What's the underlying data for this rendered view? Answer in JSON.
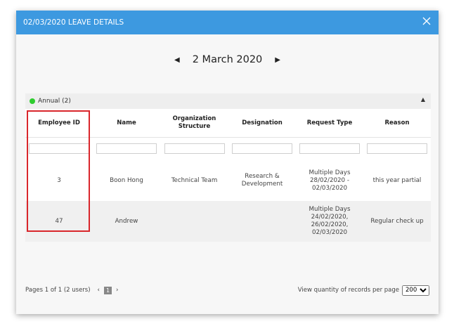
{
  "modal": {
    "title": "02/03/2020 LEAVE DETAILS",
    "date_nav": {
      "label": "2 March 2020",
      "prev": "◀",
      "next": "▶"
    }
  },
  "group": {
    "label": "Annual (2)",
    "color": "#2ecc2e",
    "collapse": "▲"
  },
  "table": {
    "columns": [
      "Employee ID",
      "Name",
      "Organization Structure",
      "Designation",
      "Request Type",
      "Reason"
    ],
    "rows": [
      {
        "employee_id": "3",
        "name": "Boon Hong",
        "org": "Technical Team",
        "designation": "Research & Development",
        "request_type": "Multiple Days 28/02/2020 - 02/03/2020",
        "reason": "this year partial"
      },
      {
        "employee_id": "47",
        "name": "Andrew",
        "org": "",
        "designation": "",
        "request_type": "Multiple Days 24/02/2020, 26/02/2020, 02/03/2020",
        "reason": "Regular check up"
      }
    ]
  },
  "footer": {
    "pages_text": "Pages 1 of 1 (2 users)",
    "prev": "‹",
    "page": "1",
    "next": "›",
    "records_label": "View quantity of records per page",
    "records_value": "200"
  },
  "colors": {
    "header": "#3d99e0",
    "highlight": "#d9262b"
  }
}
